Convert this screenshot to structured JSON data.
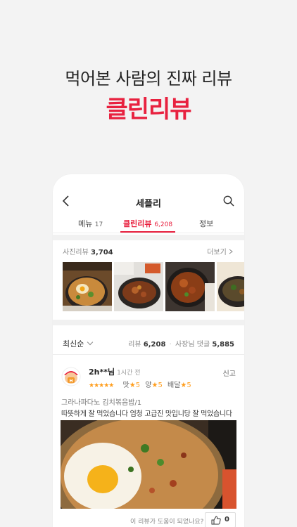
{
  "promo": {
    "headline": "먹어본 사람의 진짜 리뷰",
    "brand": "클린리뷰"
  },
  "header": {
    "title": "세플리",
    "back_icon": "back-arrow-icon",
    "search_icon": "search-icon"
  },
  "tabs": {
    "menu_label": "메뉴",
    "menu_count": "17",
    "review_label": "클린리뷰",
    "review_count": "6,208",
    "info_label": "정보"
  },
  "photo_reviews": {
    "label": "사진리뷰",
    "count": "3,704",
    "more": "더보기"
  },
  "sort": {
    "label": "최신순"
  },
  "stats": {
    "review_label": "리뷰",
    "review_count": "6,208",
    "owner_reply_label": "사장님 댓글",
    "owner_reply_count": "5,885"
  },
  "review": {
    "user": "2h**님",
    "time": "1시간 전",
    "report": "신고",
    "stars": "★★★★★",
    "taste_label": "맛",
    "taste_score": "5",
    "amount_label": "양",
    "amount_score": "5",
    "delivery_label": "배달",
    "delivery_score": "5",
    "menu": "그라나파다노 김치볶음밥/1",
    "text": "따뜻하게 잘 먹었습니다 엄청 고급진 맛입니당 잘 먹었습니다",
    "helpful_question": "이 리뷰가 도움이 되었나요?",
    "like_count": "0"
  },
  "colors": {
    "accent": "#e8213f",
    "star": "#ff9d1c"
  }
}
